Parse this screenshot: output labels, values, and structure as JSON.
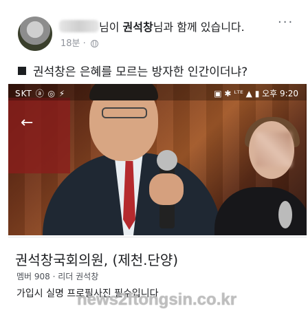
{
  "header": {
    "suffix_1": "님이 ",
    "tagged_name": "권석창",
    "suffix_2": "님과 함께 있습니다.",
    "more_glyph": "···"
  },
  "meta": {
    "time": "18분",
    "separator": "·",
    "privacy_icon": "globe-icon"
  },
  "post": {
    "bullet_icon": "square-icon",
    "text": "권석창은 은혜를 모르는 방자한 인간이더냐?"
  },
  "screenshot": {
    "status_left": "SKT ⓐ ◎ ⚡",
    "status_right": "▣ ✱ ᴸᵀᴱ ▲ ▮ 오후 9:20",
    "back_icon": "back-arrow-icon"
  },
  "group": {
    "title": "권석창국회의원, (제천.단양)",
    "sub": "멤버 908 · 리더 권석창",
    "desc": "가입시 실명 프로필사진 필수입니다"
  },
  "watermark": "news2ftongsin.co.kr"
}
